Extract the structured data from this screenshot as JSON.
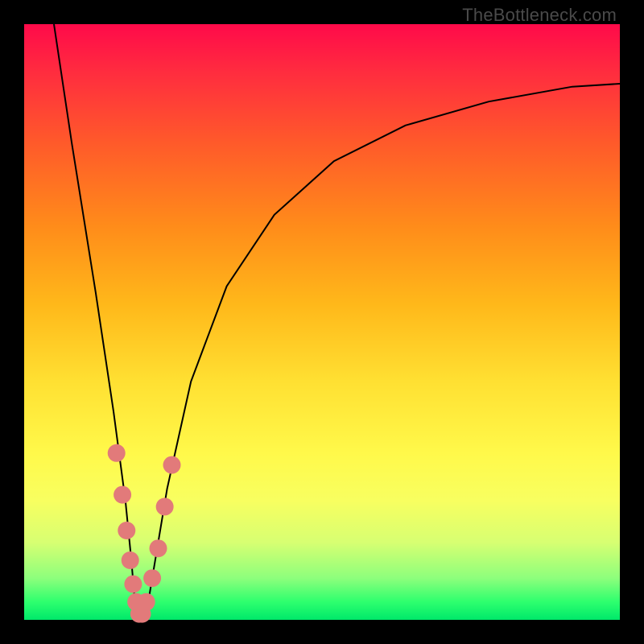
{
  "watermark": "TheBottleneck.com",
  "chart_data": {
    "type": "line",
    "title": "",
    "xlabel": "",
    "ylabel": "",
    "xlim": [
      0,
      100
    ],
    "ylim": [
      0,
      100
    ],
    "series": [
      {
        "name": "bottleneck-curve",
        "x": [
          5,
          8,
          12,
          15,
          17,
          18,
          18.5,
          19,
          19.5,
          20,
          21,
          22,
          24,
          28,
          34,
          42,
          52,
          64,
          78,
          92,
          100
        ],
        "y": [
          100,
          80,
          55,
          35,
          20,
          10,
          4,
          1,
          0,
          1,
          4,
          10,
          22,
          40,
          56,
          68,
          77,
          83,
          87,
          89.5,
          90
        ]
      }
    ],
    "markers": {
      "name": "highlighted-points",
      "x": [
        15.5,
        16.5,
        17.2,
        17.8,
        18.3,
        18.8,
        19.3,
        19.8,
        20.5,
        21.5,
        22.5,
        23.6,
        24.8
      ],
      "y": [
        28,
        21,
        15,
        10,
        6,
        3,
        1,
        1,
        3,
        7,
        12,
        19,
        26
      ],
      "color": "#e27a7a",
      "radius_px": 11
    },
    "background_gradient": {
      "direction": "vertical",
      "stops": [
        {
          "pos": 0.0,
          "color": "#ff0a4a"
        },
        {
          "pos": 0.2,
          "color": "#ff5a2a"
        },
        {
          "pos": 0.47,
          "color": "#ffb81a"
        },
        {
          "pos": 0.72,
          "color": "#fff94a"
        },
        {
          "pos": 0.93,
          "color": "#8dff7c"
        },
        {
          "pos": 1.0,
          "color": "#00e86a"
        }
      ]
    }
  }
}
